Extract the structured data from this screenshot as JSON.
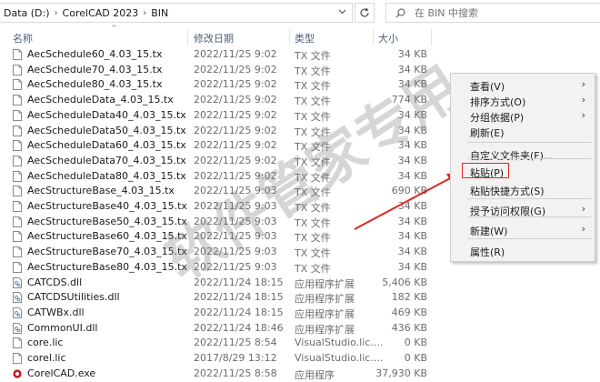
{
  "address": {
    "crumbs": [
      "Data (D:)",
      "CorelCAD 2023",
      "BIN"
    ]
  },
  "search": {
    "placeholder": "在 BIN 中搜索"
  },
  "columns": {
    "name": "名称",
    "date": "修改日期",
    "type": "类型",
    "size": "大小"
  },
  "files": [
    {
      "name": "AecSchedule60_4.03_15.tx",
      "date": "2022/11/25 9:02",
      "type": "TX 文件",
      "size": "34 KB",
      "icon": "doc"
    },
    {
      "name": "AecSchedule70_4.03_15.tx",
      "date": "2022/11/25 9:02",
      "type": "TX 文件",
      "size": "34 KB",
      "icon": "doc"
    },
    {
      "name": "AecSchedule80_4.03_15.tx",
      "date": "2022/11/25 9:02",
      "type": "TX 文件",
      "size": "34 KB",
      "icon": "doc"
    },
    {
      "name": "AecScheduleData_4.03_15.tx",
      "date": "2022/11/25 9:02",
      "type": "TX 文件",
      "size": "774 KB",
      "icon": "doc"
    },
    {
      "name": "AecScheduleData40_4.03_15.tx",
      "date": "2022/11/25 9:02",
      "type": "TX 文件",
      "size": "34 KB",
      "icon": "doc"
    },
    {
      "name": "AecScheduleData50_4.03_15.tx",
      "date": "2022/11/25 9:02",
      "type": "TX 文件",
      "size": "34 KB",
      "icon": "doc"
    },
    {
      "name": "AecScheduleData60_4.03_15.tx",
      "date": "2022/11/25 9:02",
      "type": "TX 文件",
      "size": "34 KB",
      "icon": "doc"
    },
    {
      "name": "AecScheduleData70_4.03_15.tx",
      "date": "2022/11/25 9:02",
      "type": "TX 文件",
      "size": "34 KB",
      "icon": "doc"
    },
    {
      "name": "AecScheduleData80_4.03_15.tx",
      "date": "2022/11/25 9:02",
      "type": "TX 文件",
      "size": "34 KB",
      "icon": "doc"
    },
    {
      "name": "AecStructureBase_4.03_15.tx",
      "date": "2022/11/25 9:03",
      "type": "TX 文件",
      "size": "690 KB",
      "icon": "doc"
    },
    {
      "name": "AecStructureBase40_4.03_15.tx",
      "date": "2022/11/25 9:03",
      "type": "TX 文件",
      "size": "34 KB",
      "icon": "doc"
    },
    {
      "name": "AecStructureBase50_4.03_15.tx",
      "date": "2022/11/25 9:03",
      "type": "TX 文件",
      "size": "34 KB",
      "icon": "doc"
    },
    {
      "name": "AecStructureBase60_4.03_15.tx",
      "date": "2022/11/25 9:03",
      "type": "TX 文件",
      "size": "34 KB",
      "icon": "doc"
    },
    {
      "name": "AecStructureBase70_4.03_15.tx",
      "date": "2022/11/25 9:03",
      "type": "TX 文件",
      "size": "34 KB",
      "icon": "doc"
    },
    {
      "name": "AecStructureBase80_4.03_15.tx",
      "date": "2022/11/25 9:03",
      "type": "TX 文件",
      "size": "34 KB",
      "icon": "doc"
    },
    {
      "name": "CATCDS.dll",
      "date": "2022/11/24 18:15",
      "type": "应用程序扩展",
      "size": "5,406 KB",
      "icon": "dll"
    },
    {
      "name": "CATCDSUtilities.dll",
      "date": "2022/11/24 18:15",
      "type": "应用程序扩展",
      "size": "182 KB",
      "icon": "dll"
    },
    {
      "name": "CATWBx.dll",
      "date": "2022/11/24 18:15",
      "type": "应用程序扩展",
      "size": "469 KB",
      "icon": "dll"
    },
    {
      "name": "CommonUI.dll",
      "date": "2022/11/24 18:46",
      "type": "应用程序扩展",
      "size": "436 KB",
      "icon": "dll"
    },
    {
      "name": "core.lic",
      "date": "2022/11/25 8:54",
      "type": "VisualStudio.lic....",
      "size": "0 KB",
      "icon": "doc"
    },
    {
      "name": "corel.lic",
      "date": "2017/8/29 13:12",
      "type": "VisualStudio.lic....",
      "size": "0 KB",
      "icon": "doc"
    },
    {
      "name": "CorelCAD.exe",
      "date": "2022/11/25 8:58",
      "type": "应用程序",
      "size": "37,930 KB",
      "icon": "exe"
    }
  ],
  "context_menu": {
    "items": [
      {
        "label": "查看(V)",
        "submenu": true
      },
      {
        "label": "排序方式(O)",
        "submenu": true
      },
      {
        "label": "分组依据(P)",
        "submenu": true
      },
      {
        "label": "刷新(E)",
        "submenu": false
      },
      {
        "label": "自定义文件夹(F)...",
        "submenu": false
      },
      {
        "label": "粘贴(P)",
        "submenu": false
      },
      {
        "label": "粘贴快捷方式(S)",
        "submenu": false
      },
      {
        "label": "授予访问权限(G)",
        "submenu": true
      },
      {
        "label": "新建(W)",
        "submenu": true
      },
      {
        "label": "属性(R)",
        "submenu": false
      }
    ]
  },
  "watermark": {
    "text": "软件管家专用"
  },
  "colors": {
    "highlight": "#e0261f",
    "header_text": "#4c607a",
    "dll_icon": "#6b8fb5"
  }
}
